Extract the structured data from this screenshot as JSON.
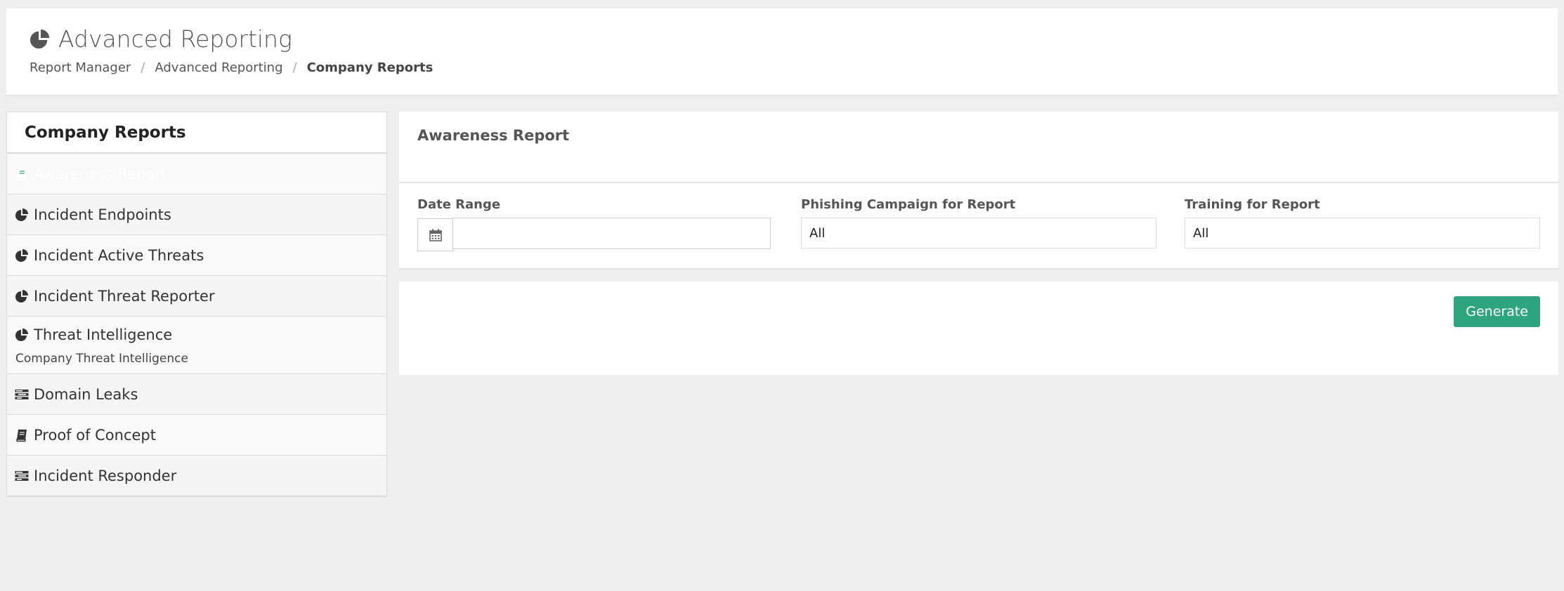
{
  "header": {
    "title": "Advanced Reporting",
    "title_icon": "pie-chart-icon",
    "breadcrumb": [
      "Report Manager",
      "Advanced Reporting",
      "Company Reports"
    ]
  },
  "sidebar": {
    "title": "Company Reports",
    "active_index": 0,
    "active_color": "#2ea57f",
    "items": [
      {
        "label": "Awareness Report",
        "icon": "book-icon"
      },
      {
        "label": "Incident Endpoints",
        "icon": "pie-chart-icon"
      },
      {
        "label": "Incident Active Threats",
        "icon": "pie-chart-icon"
      },
      {
        "label": "Incident Threat Reporter",
        "icon": "pie-chart-icon"
      },
      {
        "label": "Threat Intelligence",
        "icon": "pie-chart-icon",
        "sub": "Company Threat Intelligence"
      },
      {
        "label": "Domain Leaks",
        "icon": "tasks-icon"
      },
      {
        "label": "Proof of Concept",
        "icon": "book-icon"
      },
      {
        "label": "Incident Responder",
        "icon": "tasks-icon"
      }
    ]
  },
  "report": {
    "title": "Awareness Report",
    "date_range": {
      "label": "Date Range",
      "value": ""
    },
    "phishing": {
      "label": "Phishing Campaign for Report",
      "value": "All"
    },
    "training": {
      "label": "Training for Report",
      "value": "All"
    },
    "generate_label": "Generate"
  }
}
